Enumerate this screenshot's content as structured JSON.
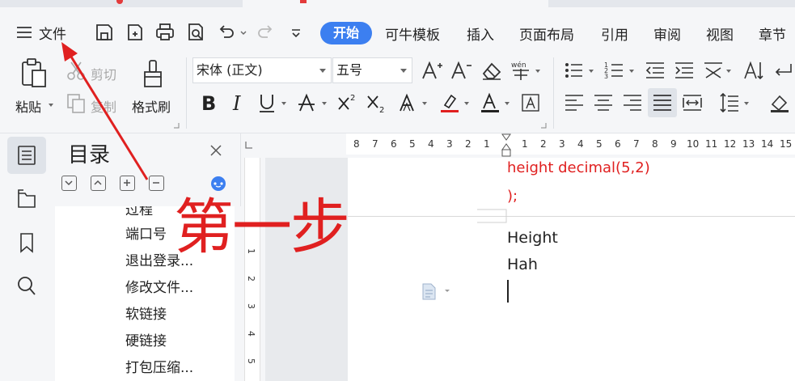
{
  "menubar": {
    "file_label": "文件",
    "tabs": [
      "开始",
      "可牛模板",
      "插入",
      "页面布局",
      "引用",
      "审阅",
      "视图",
      "章节"
    ]
  },
  "ribbon": {
    "paste_label": "粘贴",
    "cut_label": "剪切",
    "copy_label": "复制",
    "format_painter_label": "格式刷",
    "font_name": "宋体 (正文)",
    "font_size": "五号"
  },
  "toc": {
    "title": "目录",
    "items": [
      "过程",
      "端口号",
      "退出登录...",
      "修改文件...",
      "软链接",
      "硬链接",
      "打包压缩..."
    ]
  },
  "ruler": {
    "h_left": [
      "8",
      "7",
      "6",
      "5",
      "4",
      "3",
      "2",
      "1"
    ],
    "h_right": [
      "1",
      "2",
      "3",
      "4",
      "5",
      "6",
      "7",
      "8",
      "9",
      "10",
      "11",
      "12",
      "13",
      "14",
      "15"
    ],
    "v": [
      "1",
      "2",
      "3",
      "4",
      "5"
    ]
  },
  "document": {
    "code_line_1": "height decimal(5,2)",
    "code_line_2": ");",
    "line_1": "Height",
    "line_2": "Hah"
  },
  "annotation": {
    "text": "第一步",
    "color": "#e02020"
  },
  "colors": {
    "accent": "#3c7ff0",
    "font_color_bar": "#e02020"
  }
}
